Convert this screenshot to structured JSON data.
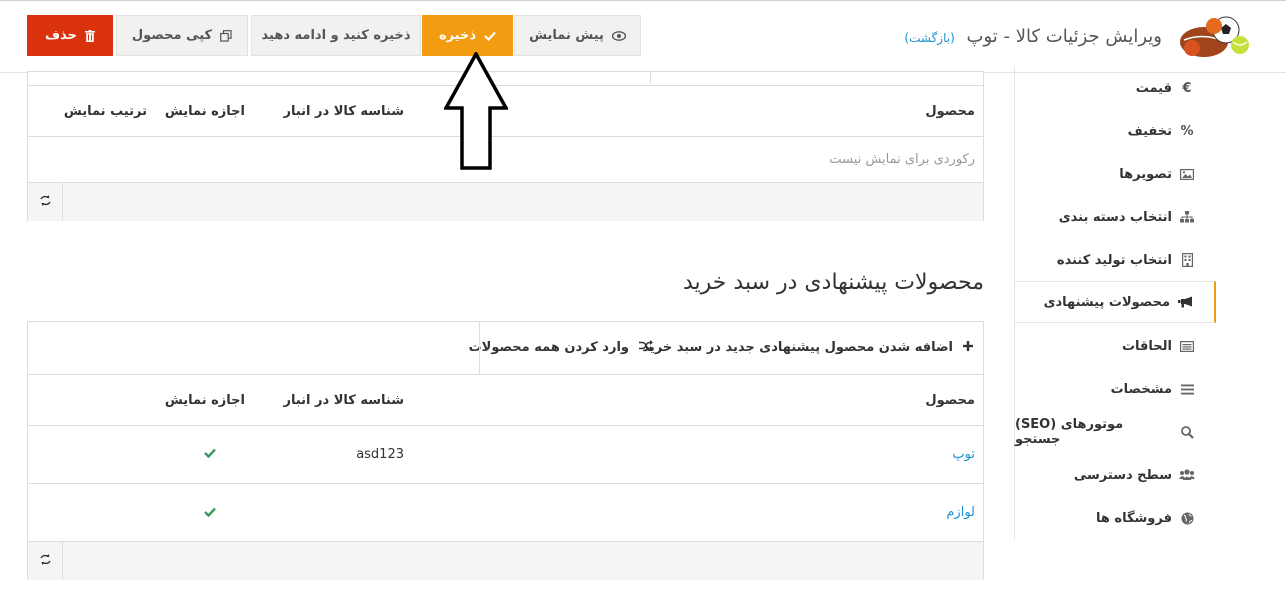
{
  "header": {
    "title": "ویرایش جزئیات کالا - توپ",
    "back_label": "(بازگشت)",
    "buttons": {
      "preview": "پیش نمایش",
      "save": "ذخیره",
      "save_continue": "ذخیره کنید و ادامه دهید",
      "copy": "کپی محصول",
      "delete": "حذف"
    }
  },
  "sidebar": {
    "items": [
      {
        "label": "قیمت",
        "icon": "euro-icon"
      },
      {
        "label": "تخفیف",
        "icon": "percent-icon"
      },
      {
        "label": "تصویرها",
        "icon": "image-icon"
      },
      {
        "label": "انتخاب دسته بندی",
        "icon": "sitemap-icon"
      },
      {
        "label": "انتخاب تولید کننده",
        "icon": "building-icon"
      },
      {
        "label": "محصولات پیشنهادی",
        "icon": "bullhorn-icon",
        "active": true
      },
      {
        "label": "الحاقات",
        "icon": "list-alt-icon"
      },
      {
        "label": "مشخصات",
        "icon": "bars-icon"
      },
      {
        "label": "(SEO) موتورهای جستجو",
        "icon": "search-icon"
      },
      {
        "label": "سطح دسترسی",
        "icon": "users-icon"
      },
      {
        "label": "فروشگاه ها",
        "icon": "globe-icon"
      }
    ]
  },
  "top_table": {
    "headers": {
      "product": "محصول",
      "sku": "شناسه کالا در انبار",
      "allow_display": "اجازه نمایش",
      "display_order": "ترتیب نمایش"
    },
    "empty_message": "رکوردی برای نمایش نیست"
  },
  "cart_section": {
    "title": "محصولات پیشنهادی در سبد خرید",
    "toolbar": {
      "add": "اضافه شدن محصول پیشنهادی جدید در سبد خرید",
      "import_all": "وارد کردن همه محصولات"
    },
    "headers": {
      "product": "محصول",
      "sku": "شناسه کالا در انبار",
      "allow_display": "اجازه نمایش"
    },
    "rows": [
      {
        "product": "توپ",
        "sku": "asd123",
        "allowed": true
      },
      {
        "product": "لوازم",
        "sku": "",
        "allowed": true
      }
    ]
  },
  "colors": {
    "save": "#f39c12",
    "delete": "#d9320c",
    "link": "#1e91cf",
    "check": "#3c9a5f"
  }
}
